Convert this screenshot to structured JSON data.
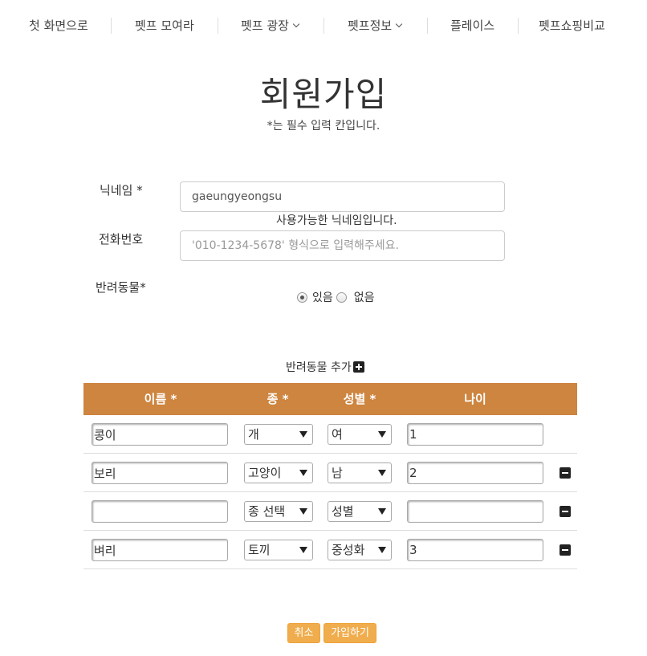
{
  "nav": {
    "items": [
      {
        "label": "첫 화면으로"
      },
      {
        "label": "펫프 모여라"
      },
      {
        "label": "펫프 광장"
      },
      {
        "label": "펫프정보"
      },
      {
        "label": "플레이스"
      },
      {
        "label": "펫프쇼핑비교"
      }
    ]
  },
  "page": {
    "title": "회원가입",
    "subtitle": "*는 필수 입력 칸입니다."
  },
  "form": {
    "nickname": {
      "label": "닉네임 *",
      "value": "gaeungyeongsu",
      "hint": "사용가능한 닉네임입니다."
    },
    "phone": {
      "label": "전화번호",
      "placeholder": "'010-1234-5678' 형식으로 입력해주세요."
    },
    "pet": {
      "label": "반려동물*",
      "options": [
        {
          "label": "있음",
          "checked": true
        },
        {
          "label": "없음",
          "checked": false
        }
      ]
    },
    "add_pet_label": "반려동물 추가"
  },
  "pet_table": {
    "headers": [
      "이름 *",
      "종 *",
      "성별 *",
      "나이"
    ],
    "rows": [
      {
        "name": "콩이",
        "species": "개",
        "gender": "여",
        "age": "1",
        "removable": false
      },
      {
        "name": "보리",
        "species": "고양이",
        "gender": "남",
        "age": "2",
        "removable": true
      },
      {
        "name": "",
        "species": "종 선택",
        "gender": "성별",
        "age": "",
        "removable": true
      },
      {
        "name": "벼리",
        "species": "토끼",
        "gender": "중성화",
        "age": "3",
        "removable": true
      }
    ]
  },
  "buttons": {
    "cancel": "취소",
    "submit": "가입하기"
  },
  "colors": {
    "table_header": "#cd853f",
    "button": "#f0ad4e"
  }
}
